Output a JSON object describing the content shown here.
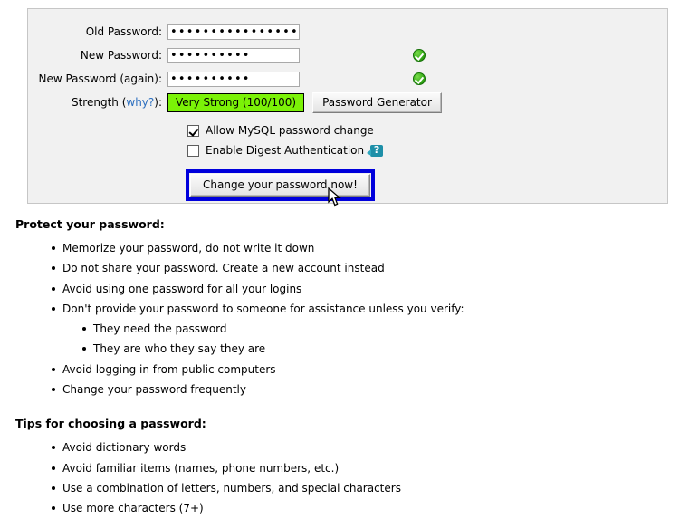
{
  "form": {
    "fields": [
      {
        "label": "Old Password:",
        "value": "••••••••••••••••",
        "placeholder": "",
        "valid": false
      },
      {
        "label": "New Password:",
        "value": "••••••••••",
        "placeholder": "",
        "valid": true
      },
      {
        "label": "New Password (again):",
        "value": "••••••••••",
        "placeholder": "",
        "valid": true
      }
    ],
    "strength": {
      "label_prefix": "Strength (",
      "label_link": "why?",
      "label_suffix": "):",
      "value": "Very Strong (100/100)",
      "score": "100/100",
      "color": "#7bf207"
    },
    "generator_button": "Password Generator",
    "checkboxes": [
      {
        "label": "Allow MySQL password change",
        "checked": true,
        "help_icon": null
      },
      {
        "label": "Enable Digest Authentication",
        "checked": false,
        "help_icon": "help-question-icon"
      }
    ],
    "submit_button": "Change your password now!",
    "submit_focus_color": "#0000dc"
  },
  "advice": {
    "protect": {
      "heading": "Protect your password:",
      "items": [
        {
          "text": "Memorize your password, do not write it down"
        },
        {
          "text": "Do not share your password. Create a new account instead"
        },
        {
          "text": "Avoid using one password for all your logins"
        },
        {
          "text": "Don't provide your password to someone for assistance unless you verify:",
          "children": [
            "They need the password",
            "They are who they say they are"
          ]
        },
        {
          "text": "Avoid logging in from public computers"
        },
        {
          "text": "Change your password frequently"
        }
      ]
    },
    "tips": {
      "heading": "Tips for choosing a password:",
      "items": [
        {
          "text": "Avoid dictionary words"
        },
        {
          "text": "Avoid familiar items (names, phone numbers, etc.)"
        },
        {
          "text": "Use a combination of letters, numbers, and special characters"
        },
        {
          "text": "Use more characters (7+)"
        }
      ]
    }
  }
}
